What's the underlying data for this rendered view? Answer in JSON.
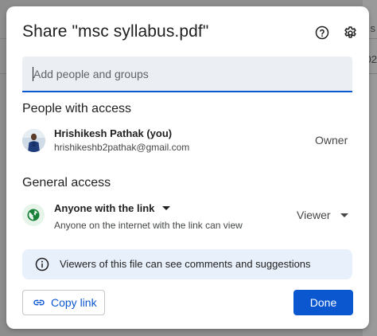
{
  "dialog": {
    "title": "Share \"msc syllabus.pdf\"",
    "help_icon": "help-circle-icon",
    "settings_icon": "gear-icon"
  },
  "add_people": {
    "placeholder": "Add people and groups",
    "value": ""
  },
  "people_with_access": {
    "heading": "People with access",
    "people": [
      {
        "name": "Hrishikesh Pathak (you)",
        "email": "hrishikeshb2pathak@gmail.com",
        "role": "Owner"
      }
    ]
  },
  "general_access": {
    "heading": "General access",
    "link_setting": "Anyone with the link",
    "description": "Anyone on the internet with the link can view",
    "role": "Viewer",
    "icon": "globe-icon",
    "icon_color": "#188038"
  },
  "info_banner": {
    "text": "Viewers of this file can see comments and suggestions",
    "icon": "info-icon"
  },
  "footer": {
    "copy_link_label": "Copy link",
    "done_label": "Done"
  },
  "background_edge": {
    "text_top": "s",
    "text_mid": "02"
  },
  "colors": {
    "accent": "#0b57d0",
    "banner_bg": "#e8f0fb",
    "input_bg": "#ebeff4",
    "globe_bg": "#e6f4ea"
  }
}
